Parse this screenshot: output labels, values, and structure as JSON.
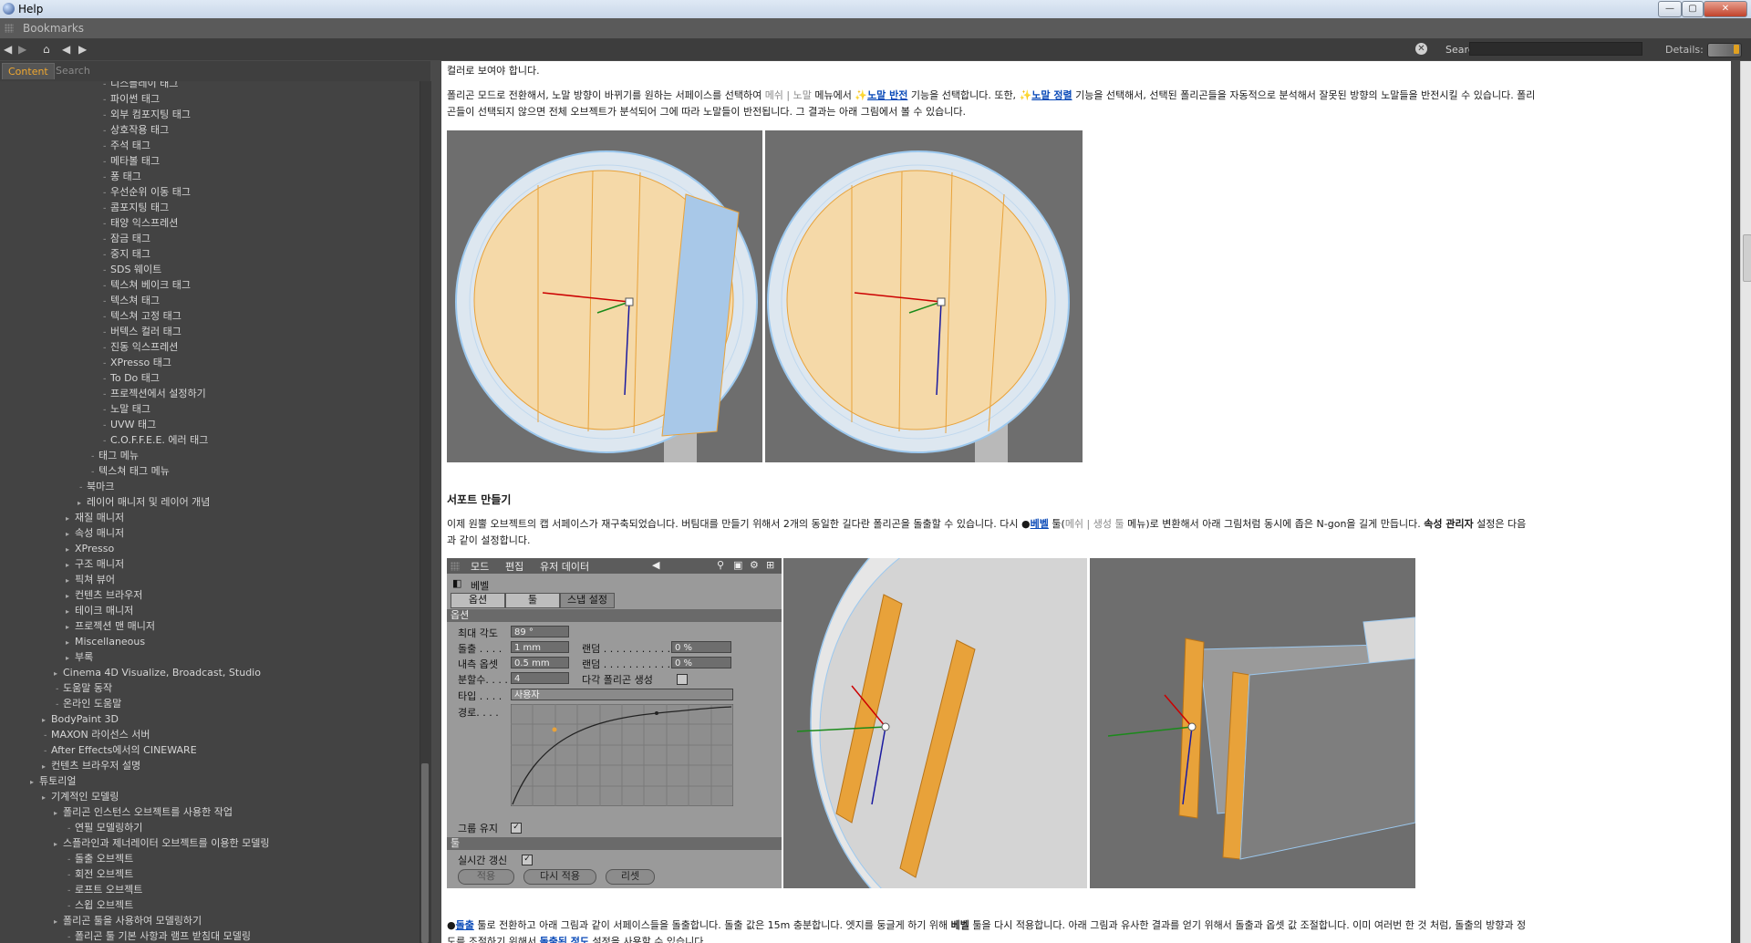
{
  "window": {
    "title": "Help",
    "controls": {
      "minimize": "—",
      "maximize": "▢",
      "close": "✕"
    }
  },
  "bookmarks": {
    "label": "Bookmarks"
  },
  "toolbar": {
    "search_label": "Search:",
    "search_value": "",
    "details_label": "Details:"
  },
  "sidebar": {
    "tabs": [
      "Content",
      "Search Results"
    ],
    "tree": [
      {
        "label": "디스플레이 태그",
        "level": 5,
        "arrow": false
      },
      {
        "label": "파이썬 태그",
        "level": 5,
        "arrow": false
      },
      {
        "label": "외부 컴포지팅 태그",
        "level": 5,
        "arrow": false
      },
      {
        "label": "상호작용 태그",
        "level": 5,
        "arrow": false
      },
      {
        "label": "주석 태그",
        "level": 5,
        "arrow": false
      },
      {
        "label": "메타볼 태그",
        "level": 5,
        "arrow": false
      },
      {
        "label": "퐁 태그",
        "level": 5,
        "arrow": false
      },
      {
        "label": "우선순위 이동 태그",
        "level": 5,
        "arrow": false
      },
      {
        "label": "콤포지팅 태그",
        "level": 5,
        "arrow": false
      },
      {
        "label": "태양 익스프레션",
        "level": 5,
        "arrow": false
      },
      {
        "label": "잠금 태그",
        "level": 5,
        "arrow": false
      },
      {
        "label": "중지 태그",
        "level": 5,
        "arrow": false
      },
      {
        "label": "SDS 웨이트",
        "level": 5,
        "arrow": false
      },
      {
        "label": "텍스쳐 베이크 태그",
        "level": 5,
        "arrow": false
      },
      {
        "label": "텍스쳐 태그",
        "level": 5,
        "arrow": false
      },
      {
        "label": "텍스쳐 고정 태그",
        "level": 5,
        "arrow": false
      },
      {
        "label": "버텍스 컬러 태그",
        "level": 5,
        "arrow": false
      },
      {
        "label": "진동 익스프레션",
        "level": 5,
        "arrow": false
      },
      {
        "label": "XPresso 태그",
        "level": 5,
        "arrow": false
      },
      {
        "label": "To Do 태그",
        "level": 5,
        "arrow": false
      },
      {
        "label": "프로젝션에서 설정하기",
        "level": 5,
        "arrow": false
      },
      {
        "label": "노말 태그",
        "level": 5,
        "arrow": false
      },
      {
        "label": "UVW 태그",
        "level": 5,
        "arrow": false
      },
      {
        "label": "C.O.F.F.E.E. 에러 태그",
        "level": 5,
        "arrow": false
      },
      {
        "label": "태그 메뉴",
        "level": 4,
        "arrow": false
      },
      {
        "label": "텍스쳐 태그 메뉴",
        "level": 4,
        "arrow": false
      },
      {
        "label": "북마크",
        "level": 3,
        "arrow": false
      },
      {
        "label": "레이어 매니저 및 레이어 개념",
        "level": 3,
        "arrow": true
      },
      {
        "label": "재질 매니저",
        "level": 2,
        "arrow": true
      },
      {
        "label": "속성 매니저",
        "level": 2,
        "arrow": true
      },
      {
        "label": "XPresso",
        "level": 2,
        "arrow": true
      },
      {
        "label": "구조 매니저",
        "level": 2,
        "arrow": true
      },
      {
        "label": "픽쳐 뷰어",
        "level": 2,
        "arrow": true
      },
      {
        "label": "컨텐츠 브라우저",
        "level": 2,
        "arrow": true
      },
      {
        "label": "테이크 매니저",
        "level": 2,
        "arrow": true
      },
      {
        "label": "프로젝션 맨 매니저",
        "level": 2,
        "arrow": true
      },
      {
        "label": "Miscellaneous",
        "level": 2,
        "arrow": true
      },
      {
        "label": "부록",
        "level": 2,
        "arrow": true
      },
      {
        "label": "Cinema 4D Visualize, Broadcast, Studio",
        "level": 1,
        "arrow": true
      },
      {
        "label": "도움말 동작",
        "level": 1,
        "arrow": false
      },
      {
        "label": "온라인 도움말",
        "level": 1,
        "arrow": false
      },
      {
        "label": "BodyPaint 3D",
        "level": 0,
        "arrow": true
      },
      {
        "label": "MAXON 라이선스 서버",
        "level": 0,
        "arrow": false
      },
      {
        "label": "After Effects에서의 CINEWARE",
        "level": 0,
        "arrow": false
      },
      {
        "label": "컨텐츠 브라우저 설명",
        "level": 0,
        "arrow": true
      },
      {
        "label": "튜토리얼",
        "level": -1,
        "arrow": true
      },
      {
        "label": "기계적인 모델링",
        "level": 0,
        "arrow": true
      },
      {
        "label": "폴리곤 인스턴스 오브젝트를 사용한 작업",
        "level": 1,
        "arrow": true
      },
      {
        "label": "연필 모델링하기",
        "level": 2,
        "arrow": false
      },
      {
        "label": "스플라인과 제너레이터 오브젝트를 이용한 모델링",
        "level": 1,
        "arrow": true
      },
      {
        "label": "돌출 오브젝트",
        "level": 2,
        "arrow": false
      },
      {
        "label": "회전 오브젝트",
        "level": 2,
        "arrow": false
      },
      {
        "label": "로프트 오브젝트",
        "level": 2,
        "arrow": false
      },
      {
        "label": "스윕 오브젝트",
        "level": 2,
        "arrow": false
      },
      {
        "label": "폴리곤 툴을 사용하여 모델링하기",
        "level": 1,
        "arrow": true
      },
      {
        "label": "폴리곤 툴 기본 사항과 램프 받침대 모델링",
        "level": 2,
        "arrow": false
      }
    ]
  },
  "content": {
    "line0": "컬러로 보여야 합니다.",
    "para1_a": "폴리곤 모드로 전환해서, 노말 방향이 바뀌기를 원하는 서페이스를 선택하여 ",
    "para1_menu1": "메쉬 | 노말",
    "para1_b": " 메뉴에서 ",
    "para1_link1": "노말 반전",
    "para1_c": " 기능을 선택합니다. 또한, ",
    "para1_link2": "노말 정렬",
    "para1_d": " 기능을 선택해서, 선택된 폴리곤들을 자동적으로 분석해서 잘못된 방향의 노말들을 반전시킬 수 있습니다. 폴리",
    "para1_line2": "곤들이 선택되지 않으면 전체 오브젝트가 분석되어 그에 따라 노말들이 반전됩니다. 그 결과는 아래 그림에서 볼 수 있습니다.",
    "heading2": "서포트 만들기",
    "para2_a": "이제 원뿔 오브젝트의 캡 서페이스가 재구축되었습니다. 버팀대를 만들기 위해서 2개의 동일한 길다란 폴리곤을 돌출할 수 있습니다. 다시 ",
    "para2_link": "베벨",
    "para2_b": " 툴(",
    "para2_menu": "메쉬 | 생성 툴",
    "para2_c": " 메뉴)로 변환해서 아래 그림처럼 동시에 좁은 N-gon을 길게 만듭니다. ",
    "para2_bold": "속성 관리자",
    "para2_d": " 설정은 다음",
    "para2_line2": "과 같이 설정합니다.",
    "para3_link": "돌출",
    "para3_a": " 툴로 전환하고 아래 그림과 같이 서페이스들을 돌출합니다. 돌출 값은 15m 충분합니다. 엣지를 둥글게 하기 위해 ",
    "para3_bold": "베벨",
    "para3_b": " 툴을 다시 적용합니다. 아래 그림과 유사한 결과를 얻기 위해서 돌출과 옵셋 값 조절합니다. 이미 여러번 한 것 처럼, 돌출의 방향과 정",
    "para3_line2a": "도를 조절하기 위해서 ",
    "para3_link2": "돌출된 정도",
    "para3_line2b": " 설정을 사용할 수 있습니다."
  },
  "bevel_panel": {
    "menu": [
      "모드",
      "편집",
      "유저 데이터"
    ],
    "title": "베벨",
    "tabs": [
      "옵션",
      "툴",
      "스냅 설정"
    ],
    "section_options": "옵션",
    "max_angle_label": "최대 각도",
    "max_angle_value": "89 °",
    "extrude_label": "돌출 . . . .",
    "extrude_value": "1 mm",
    "inner_offset_label": "내측 옵셋",
    "inner_offset_value": "0.5 mm",
    "subdiv_label": "분할수. . . .",
    "subdiv_value": "4",
    "random1_label": "랜덤 . . . . . . . . . . . .",
    "random1_value": "0 %",
    "random2_label": "랜덤 . . . . . . . . . . . .",
    "random2_value": "0 %",
    "ngon_label": "다각 폴리곤 생성",
    "type_label": "타입 . . . .",
    "type_value": "사용자",
    "path_label": "경로. . . .",
    "keep_group_label": "그룹 유지",
    "section_tool": "툴",
    "realtime_label": "실시간 갱신",
    "apply_label": "적용",
    "reapply_label": "다시 적용",
    "reset_label": "리셋"
  },
  "colors": {
    "accent": "#f0a830",
    "link": "#0a4ab8",
    "viewport_bg": "#6e6e6e",
    "sphere_fill": "#f5d9a8",
    "wire": "#9cc8ee",
    "edge": "#e8a23a"
  }
}
